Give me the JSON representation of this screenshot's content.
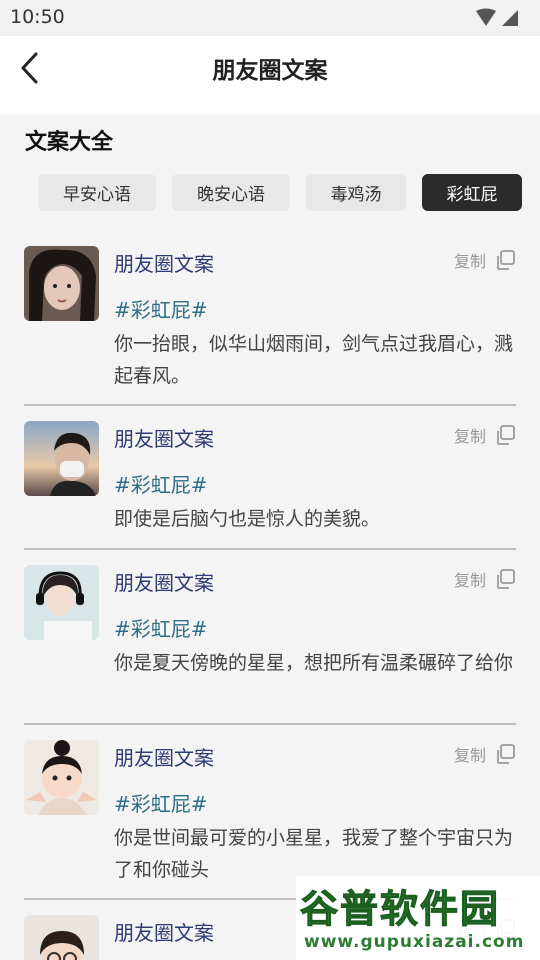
{
  "status_bar": {
    "time": "10:50"
  },
  "nav": {
    "title": "朋友圈文案"
  },
  "section_title": "文案大全",
  "tabs": [
    {
      "label": "早安心语",
      "active": false
    },
    {
      "label": "晚安心语",
      "active": false
    },
    {
      "label": "毒鸡汤",
      "active": false
    },
    {
      "label": "彩虹屁",
      "active": true
    }
  ],
  "copy_label": "复制",
  "posts": [
    {
      "name": "朋友圈文案",
      "tag": "#彩虹屁#",
      "text": "你一抬眼，似华山烟雨间，剑气点过我眉心，溅起春风。"
    },
    {
      "name": "朋友圈文案",
      "tag": "#彩虹屁#",
      "text": "即使是后脑勺也是惊人的美貌。"
    },
    {
      "name": "朋友圈文案",
      "tag": "#彩虹屁#",
      "text": "你是夏天傍晚的星星，想把所有温柔碾碎了给你"
    },
    {
      "name": "朋友圈文案",
      "tag": "#彩虹屁#",
      "text": "你是世间最可爱的小星星，我爱了整个宇宙只为了和你碰头"
    },
    {
      "name": "朋友圈文案",
      "tag": "",
      "text": ""
    }
  ],
  "watermark": {
    "title": "谷普软件园",
    "url": "www.gupuxiazai.com"
  },
  "colors": {
    "accent_tag": "#2f6f86",
    "name": "#2d3a73",
    "active_tab": "#2b2b2b"
  }
}
